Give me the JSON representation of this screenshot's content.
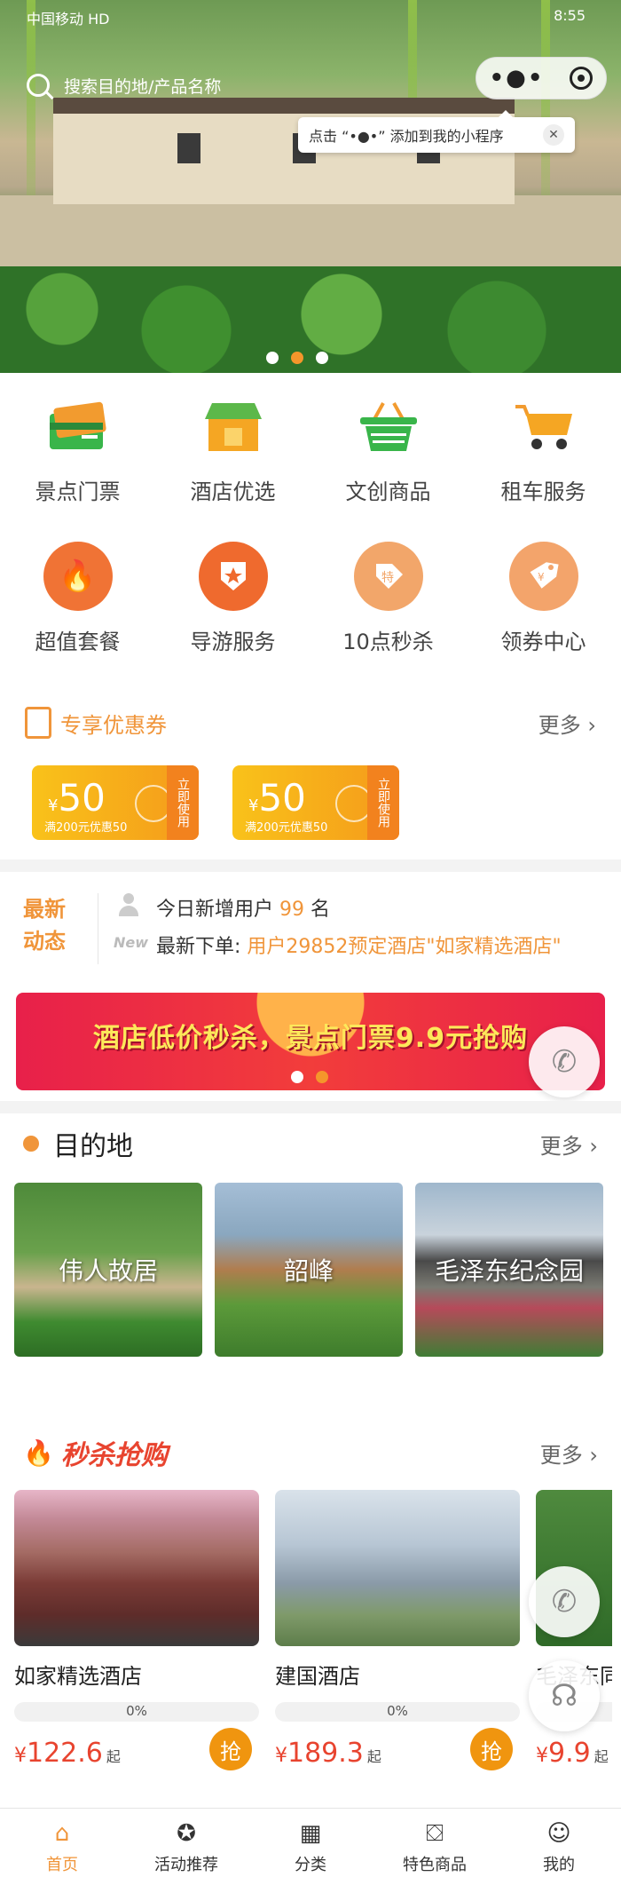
{
  "status_bar": {
    "carrier": "中国移动 HD",
    "time": "8:55"
  },
  "search": {
    "placeholder": "搜索目的地/产品名称"
  },
  "mini_program_tip": {
    "text": "点击 “•●•” 添加到我的小程序"
  },
  "categories": [
    {
      "label": "景点门票",
      "icon": "ticket-card-icon"
    },
    {
      "label": "酒店优选",
      "icon": "hotel-shop-icon"
    },
    {
      "label": "文创商品",
      "icon": "basket-icon"
    },
    {
      "label": "租车服务",
      "icon": "cart-icon"
    },
    {
      "label": "超值套餐",
      "icon": "fire-icon"
    },
    {
      "label": "导游服务",
      "icon": "badge-star-icon"
    },
    {
      "label": "10点秒杀",
      "icon": "special-tag-icon"
    },
    {
      "label": "领券中心",
      "icon": "coupon-tag-icon"
    }
  ],
  "coupons_section": {
    "title": "专享优惠券",
    "more": "更多",
    "items": [
      {
        "currency": "¥",
        "amount": "50",
        "condition": "满200元优惠50",
        "action": "立即使用"
      },
      {
        "currency": "¥",
        "amount": "50",
        "condition": "满200元优惠50",
        "action": "立即使用"
      }
    ]
  },
  "news": {
    "brand": "最新动态",
    "new_users_prefix": "今日新增用户",
    "new_users_count": "99",
    "new_users_suffix": "名",
    "order_prefix": "最新下单:",
    "order_text": "用户29852预定酒店\"如家精选酒店\""
  },
  "banner": {
    "text": "酒店低价秒杀，景点门票9.9元抢购"
  },
  "destinations_section": {
    "title": "目的地",
    "more": "更多",
    "items": [
      {
        "name": "伟人故居"
      },
      {
        "name": "韶峰"
      },
      {
        "name": "毛泽东纪念园"
      }
    ]
  },
  "flash_sale_section": {
    "title": "秒杀抢购",
    "more": "更多",
    "items": [
      {
        "name": "如家精选酒店",
        "progress": "0%",
        "progress_value": 0,
        "currency": "¥",
        "price": "122.6",
        "suffix": "起",
        "button": "抢"
      },
      {
        "name": "建国酒店",
        "progress": "0%",
        "progress_value": 0,
        "currency": "¥",
        "price": "189.3",
        "suffix": "起",
        "button": "抢"
      },
      {
        "name": "毛泽东同",
        "progress": "",
        "progress_value": 0,
        "currency": "¥",
        "price": "9.9",
        "suffix": "起",
        "button": ""
      }
    ]
  },
  "tabbar": [
    {
      "label": "首页",
      "icon": "home-icon",
      "active": true
    },
    {
      "label": "活动推荐",
      "icon": "award-icon",
      "active": false
    },
    {
      "label": "分类",
      "icon": "grid-icon",
      "active": false
    },
    {
      "label": "特色商品",
      "icon": "store-icon",
      "active": false
    },
    {
      "label": "我的",
      "icon": "user-icon",
      "active": false
    }
  ],
  "colors": {
    "accent": "#f0953a",
    "sale_red": "#e8442f",
    "grab_orange": "#f0950f"
  }
}
